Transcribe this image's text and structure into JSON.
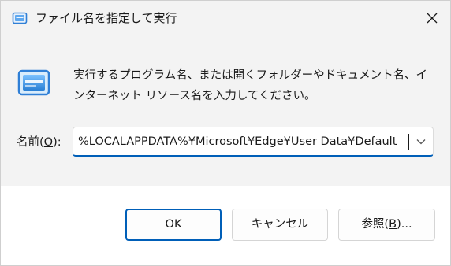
{
  "window": {
    "title": "ファイル名を指定して実行"
  },
  "dialog": {
    "description": "実行するプログラム名、または開くフォルダーやドキュメント名、インターネット リソース名を入力してください。",
    "field_label_prefix": "名前(",
    "field_label_mnemonic": "O",
    "field_label_suffix": "):",
    "field_value": "%LOCALAPPDATA%¥Microsoft¥Edge¥User Data¥Default"
  },
  "buttons": {
    "ok_label": "OK",
    "cancel_label": "キャンセル",
    "browse_prefix": "参照(",
    "browse_mnemonic": "B",
    "browse_suffix": ")..."
  },
  "icons": {
    "title_icon": "run-icon",
    "close_icon": "close-icon",
    "dropdown_icon": "chevron-down-icon"
  },
  "colors": {
    "accent": "#005fb8",
    "icon_blue": "#2f7fd6"
  }
}
